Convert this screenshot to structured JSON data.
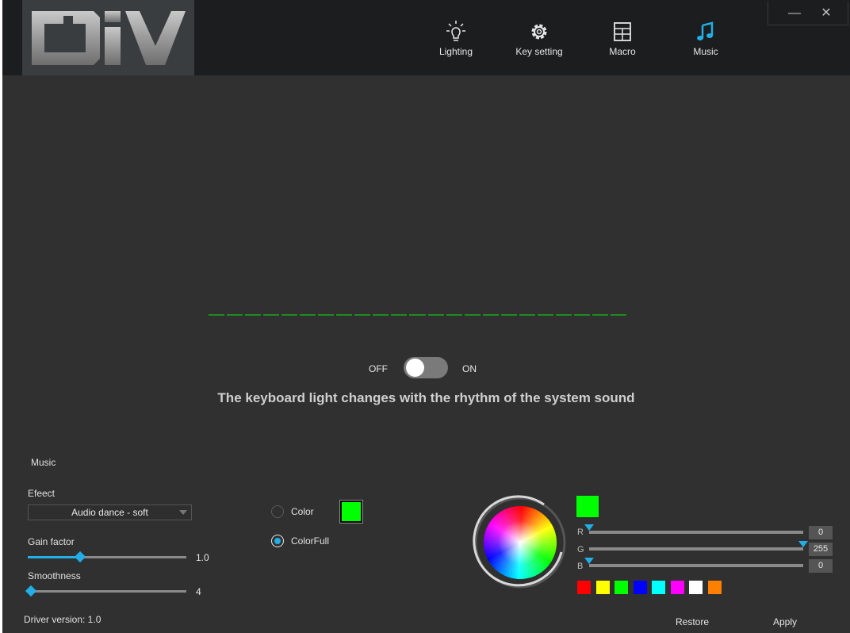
{
  "header": {
    "nav": [
      {
        "label": "Lighting",
        "icon": "bulb-icon"
      },
      {
        "label": "Key setting",
        "icon": "gear-icon"
      },
      {
        "label": "Macro",
        "icon": "grid-icon"
      },
      {
        "label": "Music",
        "icon": "music-note-icon",
        "active": true
      }
    ],
    "window_controls": {
      "minimize": "—",
      "close": "✕"
    }
  },
  "music_toggle": {
    "off_label": "OFF",
    "on_label": "ON",
    "state": "off"
  },
  "tagline": "The keyboard light changes with the rhythm of the system sound",
  "panel": {
    "section_title": "Music",
    "effect_label": "Efeect",
    "effect_value": "Audio dance - soft",
    "gain": {
      "label": "Gain factor",
      "value": "1.0",
      "fraction": 0.33
    },
    "smoothness": {
      "label": "Smoothness",
      "value": "4",
      "fraction": 0.0
    },
    "color_mode": {
      "color_label": "Color",
      "colorfull_label": "ColorFull",
      "selected": "ColorFull"
    },
    "swatch_color": "#00ff00"
  },
  "picker": {
    "selected_color": "#00ff00",
    "r": {
      "label": "R",
      "value": "0",
      "fraction": 0.0
    },
    "g": {
      "label": "G",
      "value": "255",
      "fraction": 1.0
    },
    "b": {
      "label": "B",
      "value": "0",
      "fraction": 0.0
    },
    "presets": [
      "#ff0000",
      "#ffff00",
      "#00ff00",
      "#0000ff",
      "#00ffff",
      "#ff00ff",
      "#ffffff",
      "#ff7f00"
    ]
  },
  "footer": {
    "driver_version": "Driver version: 1.0",
    "restore_label": "Restore",
    "apply_label": "Apply"
  },
  "colors": {
    "accent": "#22aee6",
    "visualizer": "#1f8a1f"
  }
}
